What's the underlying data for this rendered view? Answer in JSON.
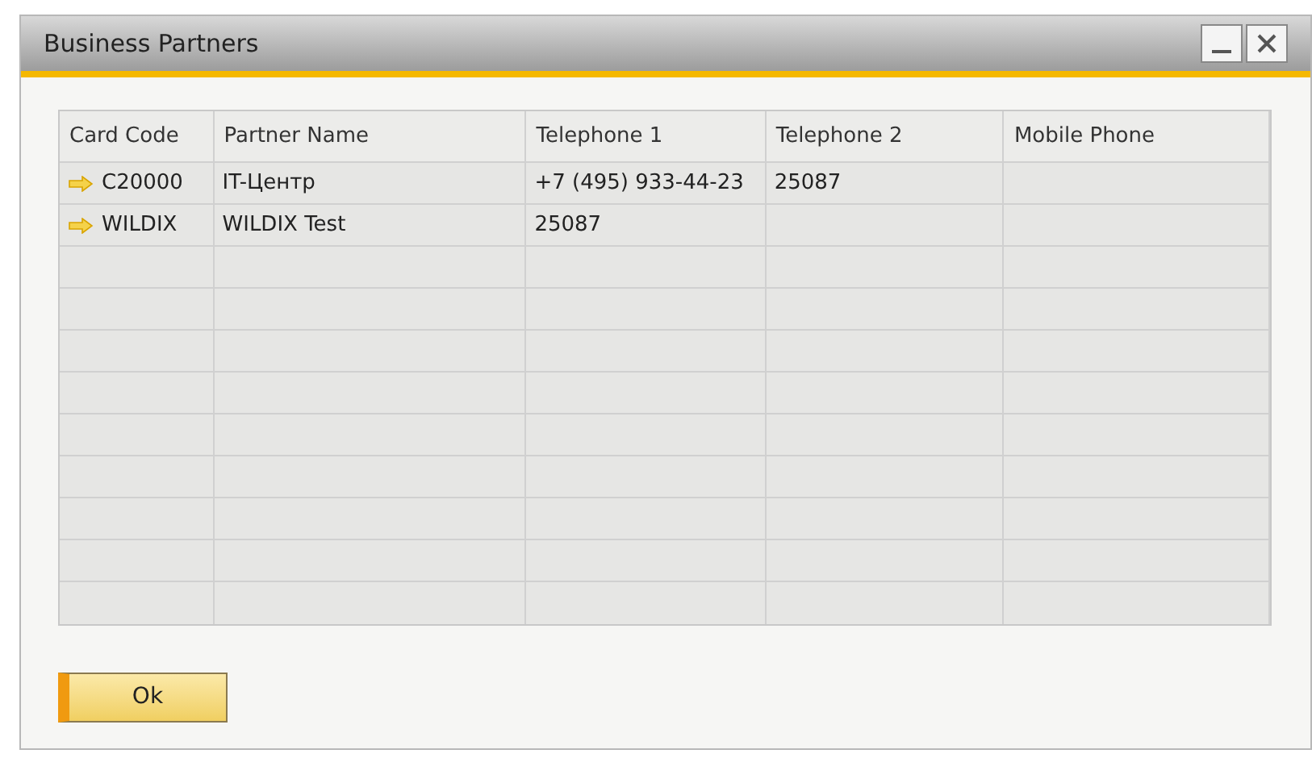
{
  "window": {
    "title": "Business Partners"
  },
  "table": {
    "columns": [
      "Card Code",
      "Partner Name",
      "Telephone 1",
      "Telephone 2",
      "Mobile Phone"
    ],
    "rows": [
      {
        "cells": [
          "C20000",
          "IT-Центр",
          "+7 (495) 933-44-23",
          "25087",
          ""
        ]
      },
      {
        "cells": [
          "WILDIX",
          "WILDIX Test",
          "25087",
          "",
          ""
        ]
      }
    ]
  },
  "buttons": [
    "Ok"
  ]
}
